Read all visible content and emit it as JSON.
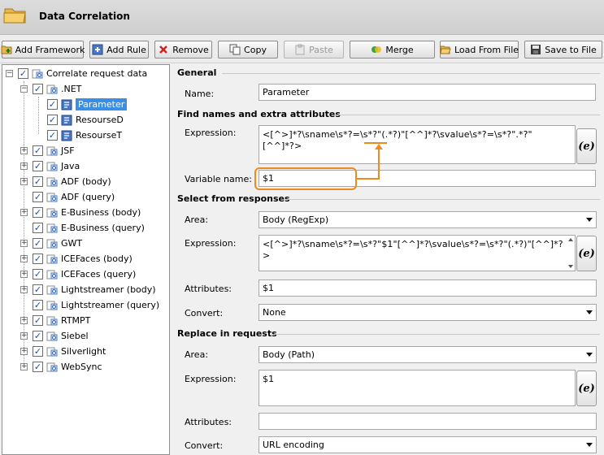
{
  "window": {
    "title": "Data Correlation"
  },
  "toolbar": {
    "add_framework": "Add Framework",
    "add_rule": "Add Rule",
    "remove": "Remove",
    "copy": "Copy",
    "paste": "Paste",
    "merge": "Merge",
    "load_from_file": "Load From File",
    "save_to_file": "Save to File"
  },
  "tree": {
    "root": "Correlate request data",
    "net": ".NET",
    "net_children": [
      "Parameter",
      "ResourseD",
      "ResourseT"
    ],
    "frameworks": [
      "JSF",
      "Java",
      "ADF (body)",
      "ADF (query)",
      "E-Business (body)",
      "E-Business (query)",
      "GWT",
      "ICEFaces (body)",
      "ICEFaces (query)",
      "Lightstreamer (body)",
      "Lightstreamer (query)",
      "RTMPT",
      "Siebel",
      "Silverlight",
      "WebSync"
    ]
  },
  "general": {
    "heading": "General",
    "name_label": "Name:",
    "name_value": "Parameter"
  },
  "find": {
    "heading": "Find names and extra attributes",
    "expression_label": "Expression:",
    "expression_pre": "<[^>]*?\\sname\\s*?=\\s*?\"",
    "expression_group": "(.*?)",
    "expression_post": "\"[^^]*?\\svalue\\s*?=\\s*?\".*?\"[^^]*?>",
    "variable_label": "Variable name:",
    "variable_value": "$1"
  },
  "select": {
    "heading": "Select from responses",
    "area_label": "Area:",
    "area_value": "Body (RegExp)",
    "expression_label": "Expression:",
    "expression_value": "<[^>]*?\\sname\\s*?=\\s*?\"$1\"[^^]*?\\svalue\\s*?=\\s*?\"(.*?)\"[^^]*?>",
    "attributes_label": "Attributes:",
    "attributes_value": "$1",
    "convert_label": "Convert:",
    "convert_value": "None"
  },
  "replace": {
    "heading": "Replace in requests",
    "area_label": "Area:",
    "area_value": "Body (Path)",
    "expression_label": "Expression:",
    "expression_value": "$1",
    "attributes_label": "Attributes:",
    "attributes_value": "",
    "convert_label": "Convert:",
    "convert_value": "URL encoding"
  },
  "editor_button_glyph": "(e)",
  "colors": {
    "highlight": "#ee8a1e",
    "selection": "#3a8ee6"
  }
}
